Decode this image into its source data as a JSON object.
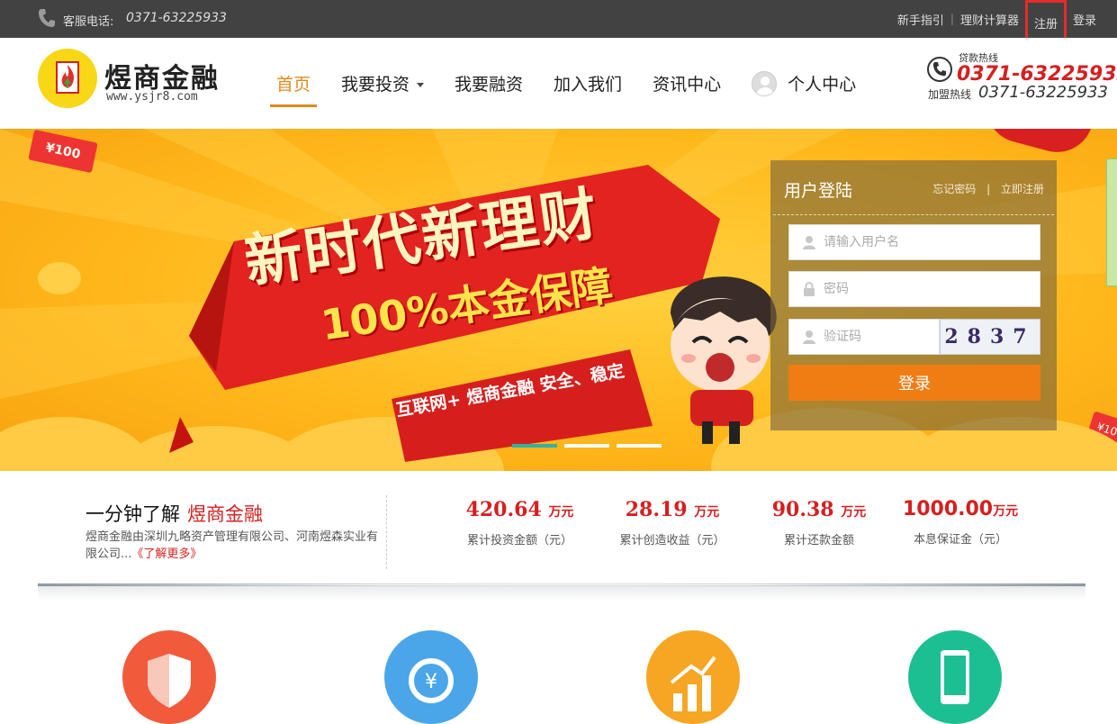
{
  "topbar": {
    "hotline_label": "客服电话:",
    "hotline_number": "0371-63225933",
    "links": {
      "guide": "新手指引",
      "calculator": "理财计算器",
      "register": "注册",
      "login": "登录"
    }
  },
  "header": {
    "brand_name": "煜商金融",
    "brand_url": "www.ysjr8.com",
    "nav": {
      "home": "首页",
      "invest": "我要投资",
      "finance": "我要融资",
      "join": "加入我们",
      "news": "资讯中心",
      "personal": "个人中心"
    },
    "hotline": {
      "title": "贷款热线",
      "loan_number": "0371-63225933",
      "join_label": "加盟热线",
      "join_number": "0371-63225933"
    }
  },
  "banner": {
    "coupon_left": "¥100",
    "coupon_right": "¥10",
    "slogan_main": "新时代新理财",
    "slogan_sub": "100%本金保障",
    "slogan_tag": "互联网+ 煜商金融   安全、稳定",
    "active_slide_index": 0,
    "slide_count": 3
  },
  "login": {
    "title": "用户登陆",
    "forgot": "忘记密码",
    "divider": "|",
    "register": "立即注册",
    "username_placeholder": "请输入用户名",
    "password_placeholder": "密码",
    "captcha_placeholder": "验证码",
    "captcha_text": "2837",
    "submit": "登录"
  },
  "intro": {
    "title_prefix": "一分钟了解",
    "title_brand": "煜商金融",
    "text": "煜商金融由深圳九略资产管理有限公司、河南煜森实业有限公司...",
    "more": "《了解更多》"
  },
  "stats": [
    {
      "value": "420.64",
      "unit": "万元",
      "label": "累计投资金额（元）"
    },
    {
      "value": "28.19",
      "unit": "万元",
      "label": "累计创造收益（元）"
    },
    {
      "value": "90.38",
      "unit": "万元",
      "label": "累计还款金额"
    },
    {
      "value": "1000.00",
      "unit": "万元",
      "label": "本息保证金（元）"
    }
  ],
  "colors": {
    "accent": "#e08a1e",
    "brand_red": "#d52020",
    "login_button": "#f07c14",
    "topbar": "#424242",
    "slide_active": "#2fb2a8",
    "feature_icons": [
      "#f15a3a",
      "#4aa6e8",
      "#f6a623",
      "#1cbf91"
    ]
  },
  "features": [
    {
      "icon": "shield-icon"
    },
    {
      "icon": "yuan-refresh-icon"
    },
    {
      "icon": "growth-chart-icon"
    },
    {
      "icon": "mobile-phone-icon"
    }
  ]
}
